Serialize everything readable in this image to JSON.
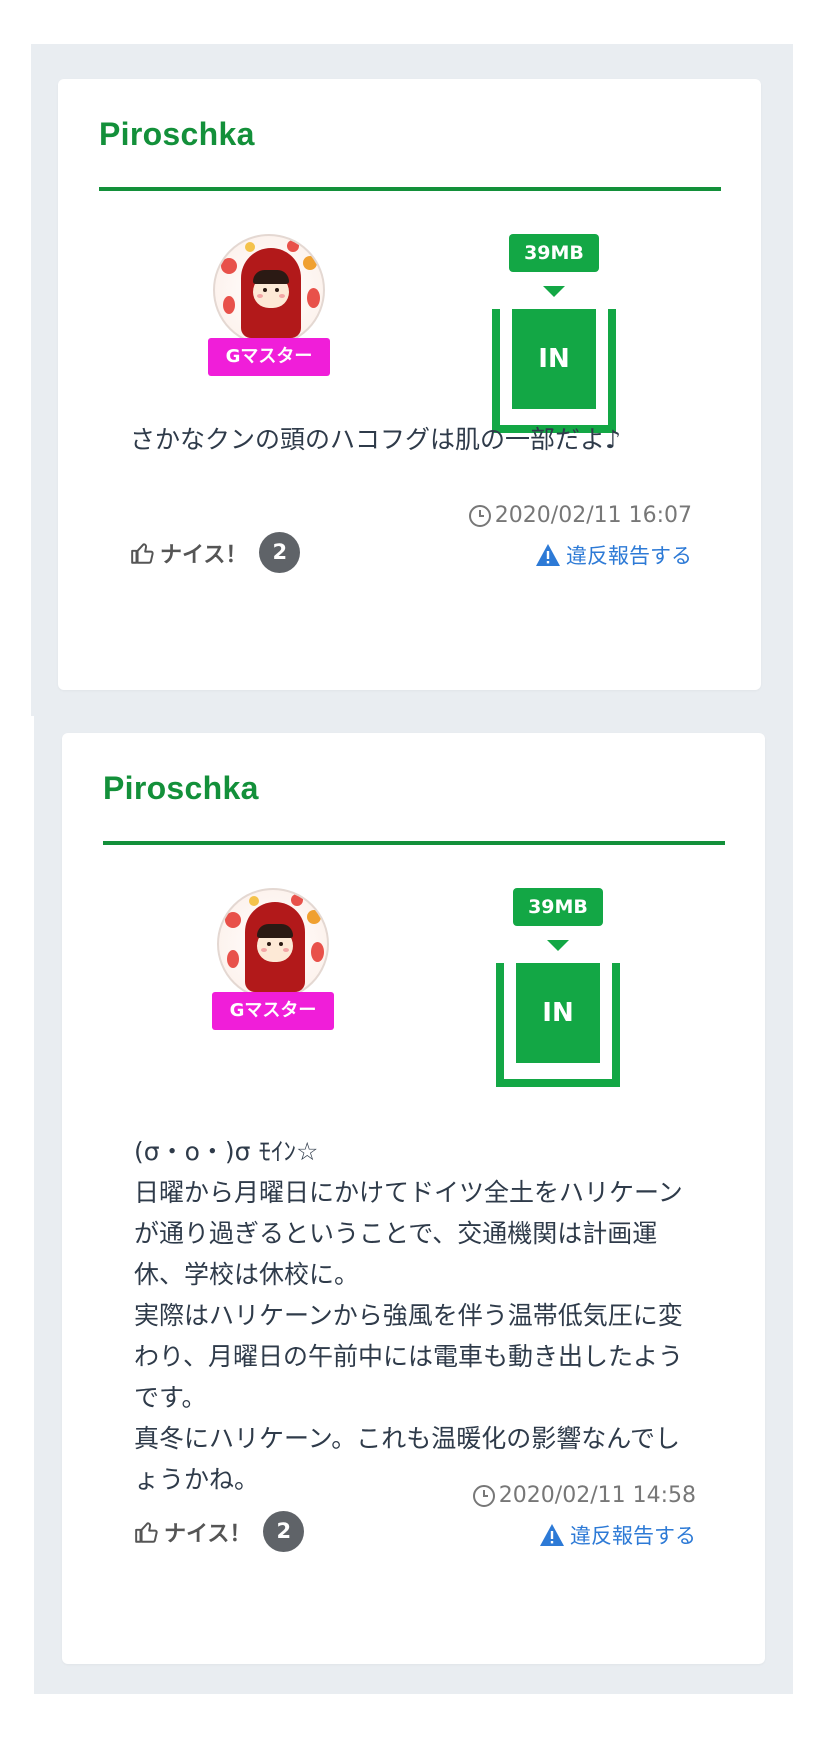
{
  "posts": [
    {
      "username": "Piroschka",
      "rank_badge": "Gマスター",
      "gift_size": "39MB",
      "gift_label": "IN",
      "message": "さかなクンの頭のハコフグは肌の一部だよ♪",
      "nice_label": "ナイス！",
      "nice_count": "2",
      "timestamp": "2020/02/11 16:07",
      "report_label": "違反報告する"
    },
    {
      "username": "Piroschka",
      "rank_badge": "Gマスター",
      "gift_size": "39MB",
      "gift_label": "IN",
      "message": "(σ・ο・)σ ﾓｲﾝ☆\n日曜から月曜日にかけてドイツ全土をハリケーンが通り過ぎるということで、交通機関は計画運休、学校は休校に。\n実際はハリケーンから強風を伴う温帯低気圧に変わり、月曜日の午前中には電車も動き出したようです。\n真冬にハリケーン。これも温暖化の影響なんでしょうかね。",
      "nice_label": "ナイス！",
      "nice_count": "2",
      "timestamp": "2020/02/11 14:58",
      "report_label": "違反報告する"
    }
  ],
  "colors": {
    "brand_green": "#13903a",
    "gift_green": "#13a745",
    "rank_magenta": "#f01ed9",
    "link_blue": "#2d7ad6",
    "page_bg": "#e9edf1"
  },
  "icons": {
    "nice": "thumbs-up-icon",
    "time": "clock-icon",
    "report": "warning-icon"
  }
}
